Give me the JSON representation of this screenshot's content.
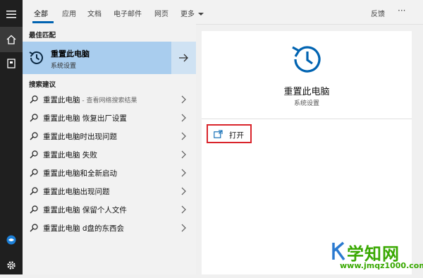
{
  "taskbar": {
    "items": [
      "hamburger-menu-icon",
      "home-icon",
      "notebook-icon",
      "feedback-hub-icon",
      "settings-gear-icon"
    ]
  },
  "tabs": {
    "items": [
      "全部",
      "应用",
      "文档",
      "电子邮件",
      "网页",
      "更多"
    ],
    "feedback_label": "反馈",
    "more_options": "···"
  },
  "left": {
    "best_match_heading": "最佳匹配",
    "best_match": {
      "title": "重置此电脑",
      "subtitle": "系统设置"
    },
    "suggestions_heading": "搜索建议",
    "suggestions": [
      {
        "text": "重置此电脑",
        "hint": " - 查看网络搜索结果"
      },
      {
        "text": "重置此电脑 恢复出厂设置",
        "hint": ""
      },
      {
        "text": "重置此电脑时出现问题",
        "hint": ""
      },
      {
        "text": "重置此电脑 失败",
        "hint": ""
      },
      {
        "text": "重置此电脑和全新启动",
        "hint": ""
      },
      {
        "text": "重置此电脑出现问题",
        "hint": ""
      },
      {
        "text": "重置此电脑 保留个人文件",
        "hint": ""
      },
      {
        "text": "重置此电脑 d盘的东西会",
        "hint": ""
      }
    ]
  },
  "preview": {
    "title": "重置此电脑",
    "subtitle": "系统设置",
    "open_label": "打开"
  },
  "watermark": {
    "brand": "学知网",
    "url": "www.jmqz1000.com"
  },
  "colors": {
    "accent": "#0063b1",
    "best_match_bg": "#a9cdee",
    "highlight_box": "#d9242b",
    "watermark_green": "#38a800"
  }
}
